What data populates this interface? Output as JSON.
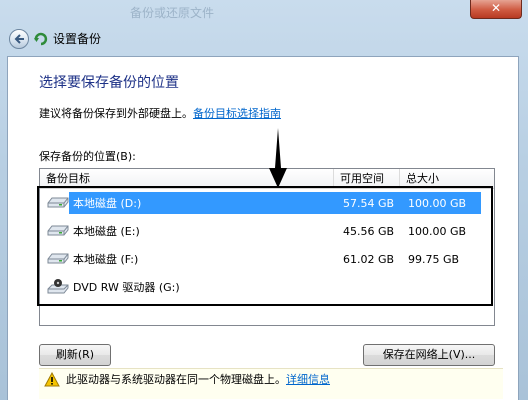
{
  "window": {
    "title": "设置备份",
    "close_glyph": "✕",
    "background_text": "备份或还原文件"
  },
  "header": {
    "heading": "选择要保存备份的位置",
    "advice": "建议将备份保存到外部硬盘上。",
    "advice_link": "备份目标选择指南"
  },
  "list": {
    "label": "保存备份的位置(B):",
    "columns": [
      "备份目标",
      "可用空间",
      "总大小"
    ],
    "rows": [
      {
        "name": "本地磁盘 (D:)",
        "free": "57.54 GB",
        "total": "100.00 GB",
        "icon": "hard-drive-icon",
        "selected": true
      },
      {
        "name": "本地磁盘 (E:)",
        "free": "45.56 GB",
        "total": "100.00 GB",
        "icon": "hard-drive-icon",
        "selected": false
      },
      {
        "name": "本地磁盘 (F:)",
        "free": "61.02 GB",
        "total": "99.75 GB",
        "icon": "hard-drive-icon",
        "selected": false
      },
      {
        "name": "DVD RW 驱动器 (G:)",
        "free": "",
        "total": "",
        "icon": "dvd-drive-icon",
        "selected": false
      }
    ]
  },
  "buttons": {
    "refresh": "刷新(R)",
    "save_network": "保存在网络上(V)..."
  },
  "warning": {
    "text": "此驱动器与系统驱动器在同一个物理磁盘上。",
    "link": "详细信息"
  },
  "colors": {
    "selection": "#3399ff",
    "heading": "#1e3287",
    "link": "#0066cc"
  }
}
